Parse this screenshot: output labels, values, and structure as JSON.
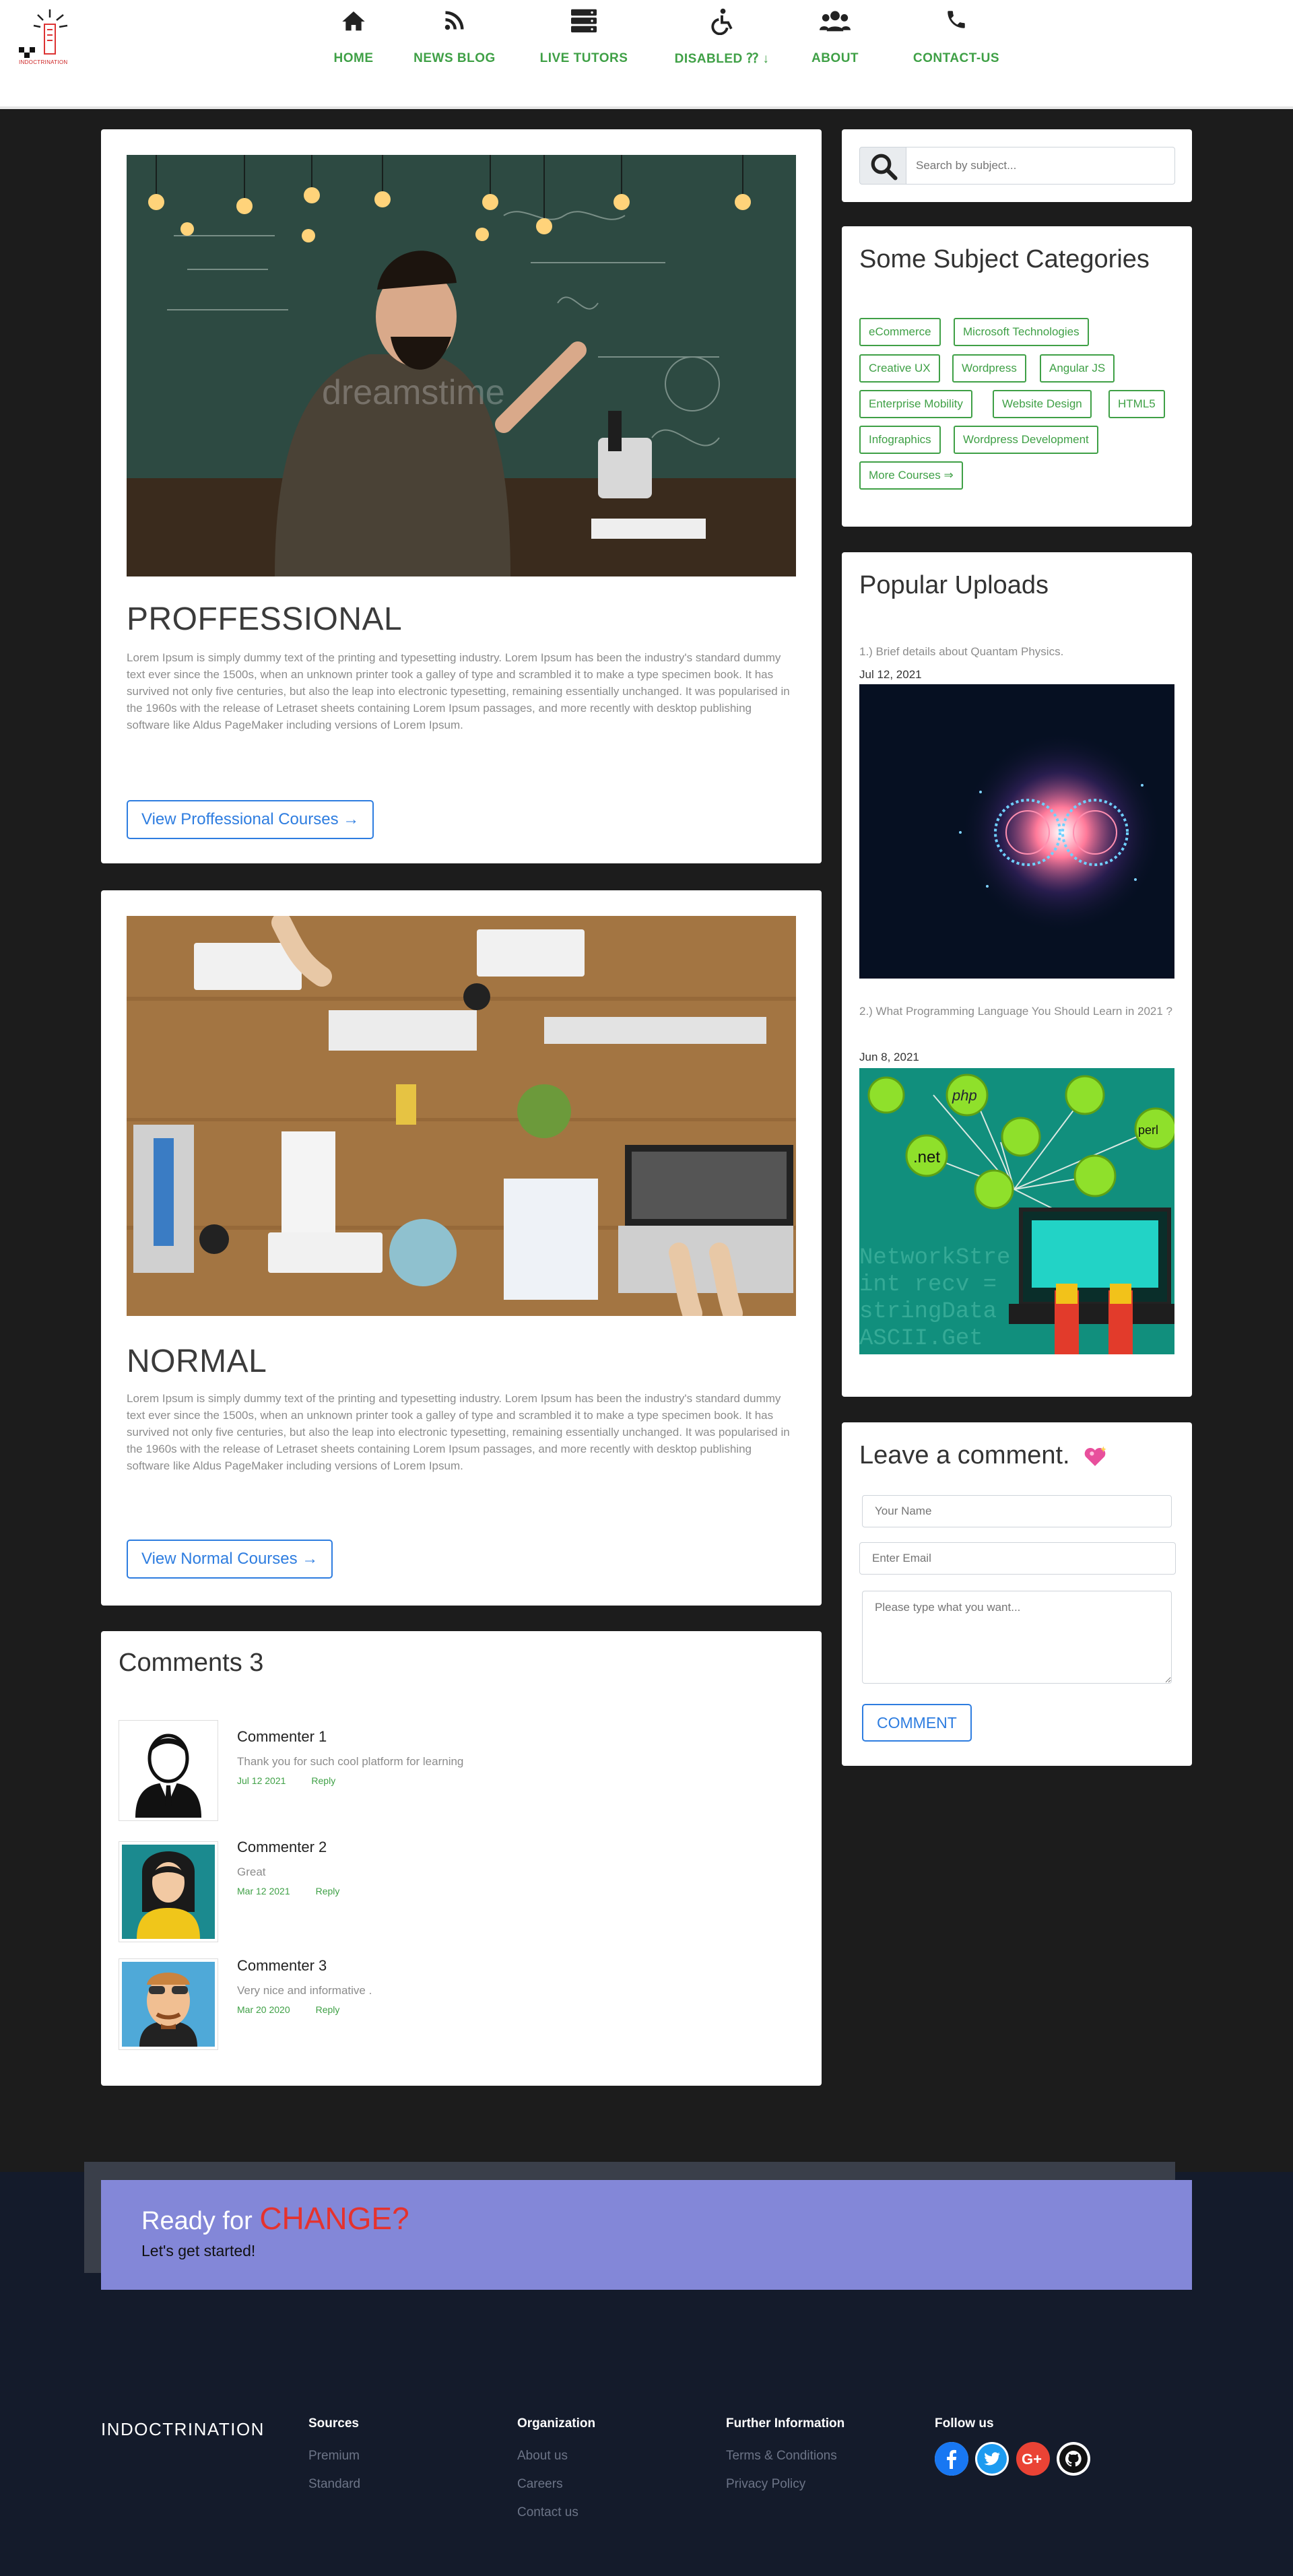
{
  "nav": {
    "items": [
      {
        "label": "HOME",
        "icon": "home-icon"
      },
      {
        "label": "NEWS BLOG",
        "icon": "rss-icon"
      },
      {
        "label": "LIVE TUTORS",
        "icon": "server-icon"
      },
      {
        "label": "DISABLED ⁇ ↓",
        "icon": "wheelchair-icon"
      },
      {
        "label": "ABOUT",
        "icon": "users-icon"
      },
      {
        "label": "CONTACT-US",
        "icon": "phone-icon"
      }
    ],
    "accent": "#3fa046"
  },
  "logo": {
    "text": "INDOCTRINATION"
  },
  "posts": [
    {
      "title": "PROFFESSIONAL",
      "text": "Lorem Ipsum is simply dummy text of the printing and typesetting industry. Lorem Ipsum has been the industry's standard dummy text ever since the 1500s, when an unknown printer took a galley of type and scrambled it to make a type specimen book. It has survived not only five centuries, but also the leap into electronic typesetting, remaining essentially unchanged. It was popularised in the 1960s with the release of Letraset sheets containing Lorem Ipsum passages, and more recently with desktop publishing software like Aldus PageMaker including versions of Lorem Ipsum.",
      "button": "View Proffessional Courses →",
      "watermark": "dreamstime"
    },
    {
      "title": "NORMAL",
      "text": "Lorem Ipsum is simply dummy text of the printing and typesetting industry. Lorem Ipsum has been the industry's standard dummy text ever since the 1500s, when an unknown printer took a galley of type and scrambled it to make a type specimen book. It has survived not only five centuries, but also the leap into electronic typesetting, remaining essentially unchanged. It was popularised in the 1960s with the release of Letraset sheets containing Lorem Ipsum passages, and more recently with desktop publishing software like Aldus PageMaker including versions of Lorem Ipsum.",
      "button": "View Normal Courses →"
    }
  ],
  "comments": {
    "title": "Comments 3",
    "items": [
      {
        "name": "Commenter 1",
        "text": "Thank you for such cool platform for learning",
        "date": "Jul 12 2021",
        "reply": "Reply"
      },
      {
        "name": "Commenter 2",
        "text": "Great",
        "date": "Mar 12 2021",
        "reply": "Reply"
      },
      {
        "name": "Commenter 3",
        "text": "Very nice and informative .",
        "date": "Mar 20 2020",
        "reply": "Reply"
      }
    ]
  },
  "search": {
    "placeholder": "Search by subject..."
  },
  "categories": {
    "title": "Some Subject Categories",
    "tags": [
      "eCommerce",
      "Microsoft Technologies",
      "Creative UX",
      "Wordpress",
      "Angular JS",
      "Enterprise Mobility",
      "Website Design",
      "HTML5",
      "Infographics",
      "Wordpress Development",
      "More Courses ⇒"
    ]
  },
  "popular": {
    "title": "Popular Uploads",
    "items": [
      {
        "text": "1.) Brief details about Quantam Physics.",
        "date": "Jul 12, 2021"
      },
      {
        "text": "2.) What Programming Language You Should Learn in 2021 ?",
        "date": "Jun 8, 2021"
      }
    ],
    "code_labels": [
      ".net",
      "php",
      "perl"
    ]
  },
  "leave_comment": {
    "title": "Leave a comment.",
    "name_placeholder": "Your Name",
    "email_placeholder": "Enter Email",
    "message_placeholder": "Please type what you want...",
    "button": "COMMENT"
  },
  "cta": {
    "title_prefix": "Ready for",
    "title_highlight": "CHANGE?",
    "subtitle": "Let's get started!",
    "bg": "#8387d8",
    "highlight_color": "#e5322d"
  },
  "footer": {
    "brand": "INDOCTRINATION",
    "columns": [
      {
        "heading": "Sources",
        "links": [
          "Premium",
          "Standard"
        ]
      },
      {
        "heading": "Organization",
        "links": [
          "About us",
          "Careers",
          "Contact us"
        ]
      },
      {
        "heading": "Further Information",
        "links": [
          "Terms & Conditions",
          "Privacy Policy"
        ]
      }
    ],
    "follow": {
      "heading": "Follow us",
      "icons": [
        "facebook-icon",
        "twitter-icon",
        "google-plus-icon",
        "github-icon"
      ]
    }
  }
}
